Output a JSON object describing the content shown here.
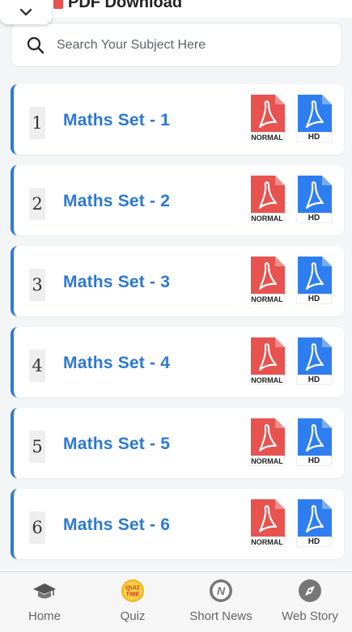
{
  "header": {
    "title": "PDF Download",
    "collapse_icon": "chevron-down-icon"
  },
  "search": {
    "placeholder": "Search Your Subject Here",
    "value": "",
    "icon": "search-icon"
  },
  "sets": [
    {
      "num": "1",
      "title": "Maths Set - 1",
      "normal_label": "NORMAL",
      "hd_label": "HD"
    },
    {
      "num": "2",
      "title": "Maths Set - 2",
      "normal_label": "NORMAL",
      "hd_label": "HD"
    },
    {
      "num": "3",
      "title": "Maths Set - 3",
      "normal_label": "NORMAL",
      "hd_label": "HD"
    },
    {
      "num": "4",
      "title": "Maths Set - 4",
      "normal_label": "NORMAL",
      "hd_label": "HD"
    },
    {
      "num": "5",
      "title": "Maths Set - 5",
      "normal_label": "NORMAL",
      "hd_label": "HD"
    },
    {
      "num": "6",
      "title": "Maths Set - 6",
      "normal_label": "NORMAL",
      "hd_label": "HD"
    }
  ],
  "nav": {
    "home": {
      "label": "Home",
      "icon": "graduation-cap-icon"
    },
    "quiz": {
      "label": "Quiz",
      "icon": "quiz-time-icon",
      "badge_line1": "QUIZ",
      "badge_line2": "TIME"
    },
    "short_news": {
      "label": "Short News",
      "icon": "news-n-icon"
    },
    "web_story": {
      "label": "Web Story",
      "icon": "compass-icon"
    }
  },
  "colors": {
    "accent": "#2c78d6",
    "card_border": "#2a7bd8",
    "pdf_normal": "#e8524f",
    "pdf_hd": "#2f7ef0",
    "background": "#f4f5f7"
  }
}
